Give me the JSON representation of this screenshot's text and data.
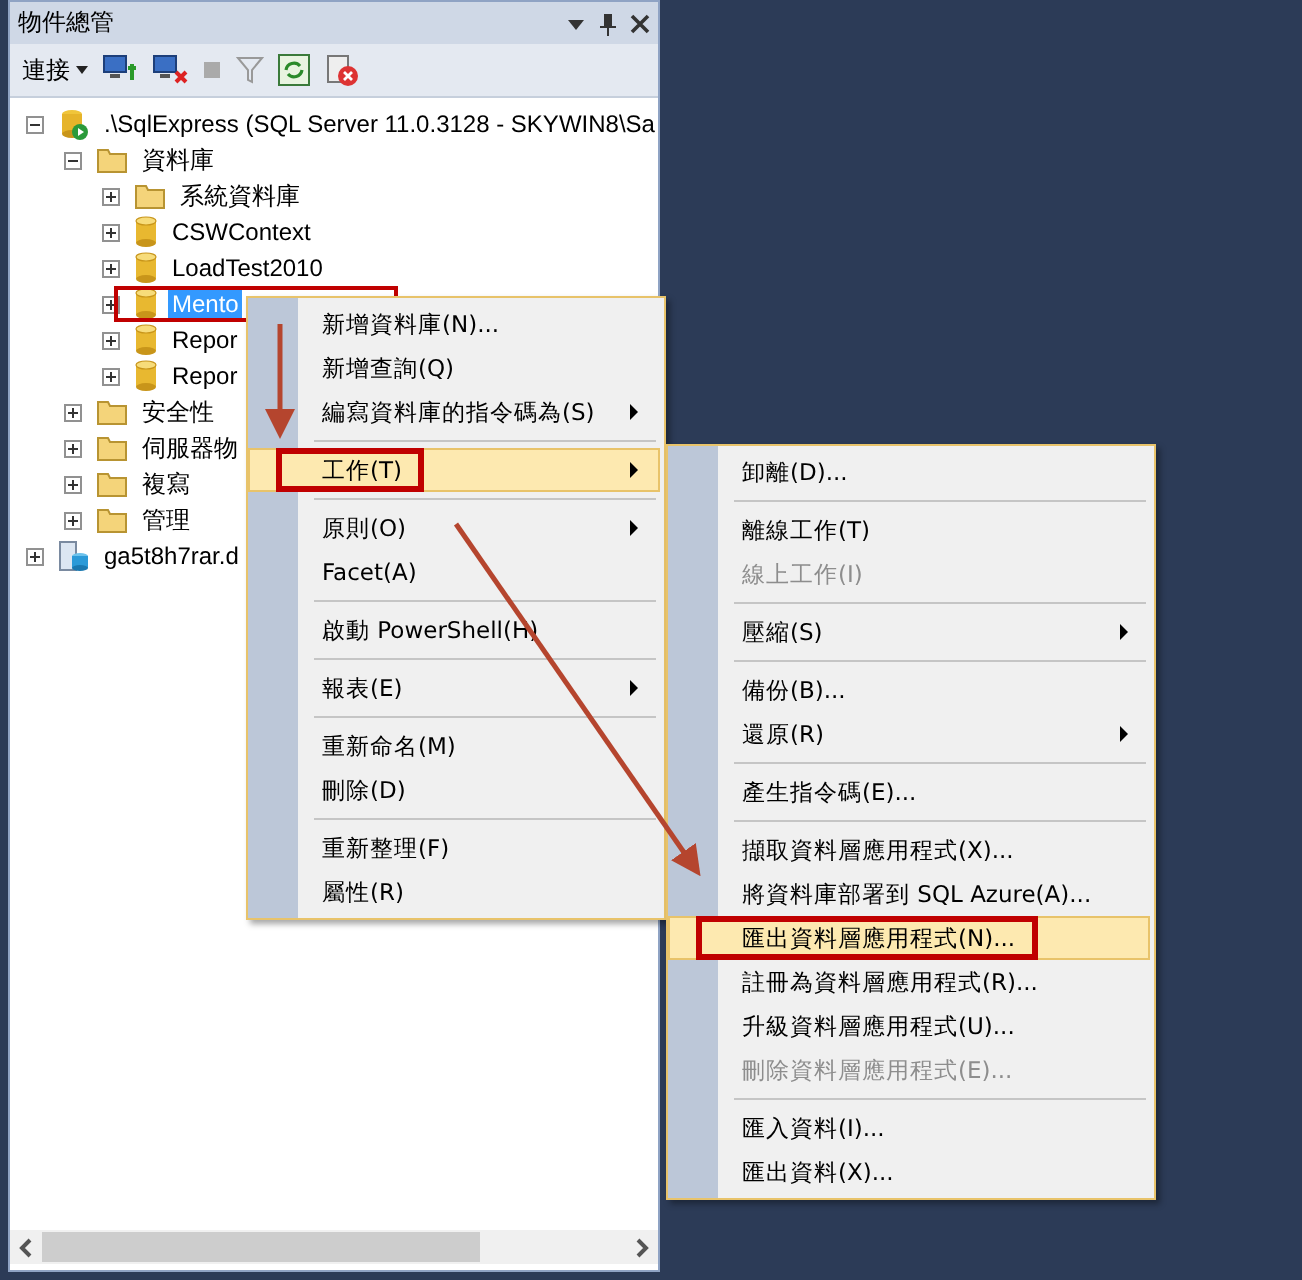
{
  "panel": {
    "title": "物件總管"
  },
  "toolbar": {
    "connect_label": "連接"
  },
  "tree": [
    {
      "label": ".\\SqlExpress (SQL Server 11.0.3128 - SKYWIN8\\Sa",
      "kind": "server",
      "expanded": true,
      "selected": false,
      "children": [
        {
          "label": "資料庫",
          "kind": "folder",
          "expanded": true,
          "selected": false,
          "children": [
            {
              "label": "系統資料庫",
              "kind": "folder",
              "expanded": false,
              "selected": false
            },
            {
              "label": "CSWContext",
              "kind": "database",
              "expanded": false,
              "selected": false
            },
            {
              "label": "LoadTest2010",
              "kind": "database",
              "expanded": false,
              "selected": false
            },
            {
              "label": "Mento",
              "kind": "database",
              "expanded": false,
              "selected": true,
              "annotated": true
            },
            {
              "label": "Repor",
              "kind": "database",
              "expanded": false,
              "selected": false
            },
            {
              "label": "Repor",
              "kind": "database",
              "expanded": false,
              "selected": false
            }
          ]
        },
        {
          "label": "安全性",
          "kind": "folder",
          "expanded": false,
          "selected": false
        },
        {
          "label": "伺服器物",
          "kind": "folder",
          "expanded": false,
          "selected": false
        },
        {
          "label": "複寫",
          "kind": "folder",
          "expanded": false,
          "selected": false
        },
        {
          "label": "管理",
          "kind": "folder",
          "expanded": false,
          "selected": false
        }
      ]
    },
    {
      "label": "ga5t8h7rar.d",
      "kind": "cloud-server",
      "expanded": false,
      "selected": false
    }
  ],
  "context_menu": [
    {
      "kind": "item",
      "label": "新增資料庫(N)...",
      "highlighted": false,
      "disabled": false,
      "submenu": false
    },
    {
      "kind": "item",
      "label": "新增查詢(Q)",
      "highlighted": false,
      "disabled": false,
      "submenu": false
    },
    {
      "kind": "item",
      "label": "編寫資料庫的指令碼為(S)",
      "highlighted": false,
      "disabled": false,
      "submenu": true
    },
    {
      "kind": "separator"
    },
    {
      "kind": "item",
      "label": "工作(T)",
      "highlighted": true,
      "disabled": false,
      "submenu": true,
      "annotated": true
    },
    {
      "kind": "separator"
    },
    {
      "kind": "item",
      "label": "原則(O)",
      "highlighted": false,
      "disabled": false,
      "submenu": true
    },
    {
      "kind": "item",
      "label": "Facet(A)",
      "highlighted": false,
      "disabled": false,
      "submenu": false
    },
    {
      "kind": "separator"
    },
    {
      "kind": "item",
      "label": "啟動 PowerShell(H)",
      "highlighted": false,
      "disabled": false,
      "submenu": false
    },
    {
      "kind": "separator"
    },
    {
      "kind": "item",
      "label": "報表(E)",
      "highlighted": false,
      "disabled": false,
      "submenu": true
    },
    {
      "kind": "separator"
    },
    {
      "kind": "item",
      "label": "重新命名(M)",
      "highlighted": false,
      "disabled": false,
      "submenu": false
    },
    {
      "kind": "item",
      "label": "刪除(D)",
      "highlighted": false,
      "disabled": false,
      "submenu": false
    },
    {
      "kind": "separator"
    },
    {
      "kind": "item",
      "label": "重新整理(F)",
      "highlighted": false,
      "disabled": false,
      "submenu": false
    },
    {
      "kind": "item",
      "label": "屬性(R)",
      "highlighted": false,
      "disabled": false,
      "submenu": false
    }
  ],
  "tasks_submenu": [
    {
      "kind": "item",
      "label": "卸離(D)...",
      "highlighted": false,
      "disabled": false,
      "submenu": false
    },
    {
      "kind": "separator"
    },
    {
      "kind": "item",
      "label": "離線工作(T)",
      "highlighted": false,
      "disabled": false,
      "submenu": false
    },
    {
      "kind": "item",
      "label": "線上工作(I)",
      "highlighted": false,
      "disabled": true,
      "submenu": false
    },
    {
      "kind": "separator"
    },
    {
      "kind": "item",
      "label": "壓縮(S)",
      "highlighted": false,
      "disabled": false,
      "submenu": true
    },
    {
      "kind": "separator"
    },
    {
      "kind": "item",
      "label": "備份(B)...",
      "highlighted": false,
      "disabled": false,
      "submenu": false
    },
    {
      "kind": "item",
      "label": "還原(R)",
      "highlighted": false,
      "disabled": false,
      "submenu": true
    },
    {
      "kind": "separator"
    },
    {
      "kind": "item",
      "label": "產生指令碼(E)...",
      "highlighted": false,
      "disabled": false,
      "submenu": false
    },
    {
      "kind": "separator"
    },
    {
      "kind": "item",
      "label": "擷取資料層應用程式(X)...",
      "highlighted": false,
      "disabled": false,
      "submenu": false
    },
    {
      "kind": "item",
      "label": "將資料庫部署到 SQL Azure(A)...",
      "highlighted": false,
      "disabled": false,
      "submenu": false
    },
    {
      "kind": "item",
      "label": "匯出資料層應用程式(N)...",
      "highlighted": true,
      "disabled": false,
      "submenu": false,
      "annotated": true
    },
    {
      "kind": "item",
      "label": "註冊為資料層應用程式(R)...",
      "highlighted": false,
      "disabled": false,
      "submenu": false
    },
    {
      "kind": "item",
      "label": "升級資料層應用程式(U)...",
      "highlighted": false,
      "disabled": false,
      "submenu": false
    },
    {
      "kind": "item",
      "label": "刪除資料層應用程式(E)...",
      "highlighted": false,
      "disabled": true,
      "submenu": false
    },
    {
      "kind": "separator"
    },
    {
      "kind": "item",
      "label": "匯入資料(I)...",
      "highlighted": false,
      "disabled": false,
      "submenu": false
    },
    {
      "kind": "item",
      "label": "匯出資料(X)...",
      "highlighted": false,
      "disabled": false,
      "submenu": false
    }
  ]
}
